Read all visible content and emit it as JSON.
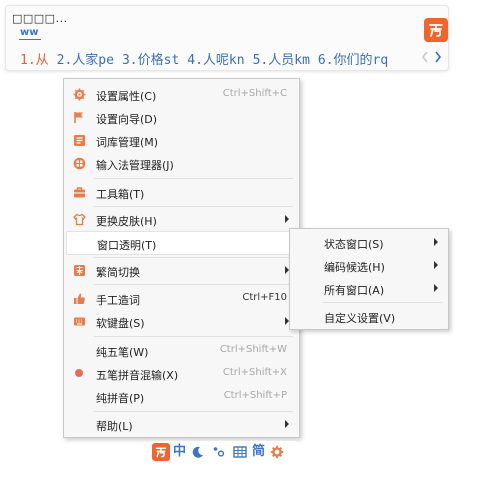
{
  "candidate": {
    "composition_text": "□□□□...",
    "pinyin": "ww",
    "items": [
      "1.从",
      "2.人家pe",
      "3.价格st",
      "4.人呢kn",
      "5.人员km",
      "6.你们的rq"
    ],
    "prev_symbol": "‹",
    "next_symbol": "›"
  },
  "menu": {
    "settings": {
      "label": "设置属性(C)",
      "shortcut": "Ctrl+Shift+C"
    },
    "wizard": {
      "label": "设置向导(D)"
    },
    "dict": {
      "label": "词库管理(M)"
    },
    "ime_manager": {
      "label": "输入法管理器(J)"
    },
    "toolbox": {
      "label": "工具箱(T)"
    },
    "skin": {
      "label": "更换皮肤(H)"
    },
    "transparency": {
      "label": "窗口透明(T)"
    },
    "trad_simp": {
      "label": "繁简切换"
    },
    "manual_word": {
      "label": "手工造词",
      "shortcut": "Ctrl+F10"
    },
    "soft_keyboard": {
      "label": "软键盘(S)"
    },
    "wubi": {
      "label": "纯五笔(W)",
      "shortcut": "Ctrl+Shift+W"
    },
    "wubi_pinyin": {
      "label": "五笔拼音混输(X)",
      "shortcut": "Ctrl+Shift+X"
    },
    "pinyin": {
      "label": "纯拼音(P)",
      "shortcut": "Ctrl+Shift+P"
    },
    "help": {
      "label": "帮助(L)"
    }
  },
  "submenu": {
    "status_window": "状态窗口(S)",
    "coding_candidate": "编码候选(H)",
    "all_windows": "所有窗口(A)",
    "custom": "自定义设置(V)"
  },
  "statusbar": {
    "lang": "中",
    "script": "简"
  },
  "colors": {
    "brand": "#f0642d",
    "candidate_blue": "#3a6fb8",
    "candidate_selected": "#e2603a",
    "icon_orange": "#ea7b4b",
    "radio_red": "#e86a5a"
  },
  "icons": [
    "gear-icon",
    "flag-icon",
    "dict-icon",
    "manager-icon",
    "toolbox-icon",
    "shirt-icon",
    "trad-simp-icon",
    "thumb-icon",
    "keyboard-icon",
    "radio-dot-icon",
    "moon-icon",
    "dots-icon",
    "grid-icon",
    "settings-icon"
  ]
}
